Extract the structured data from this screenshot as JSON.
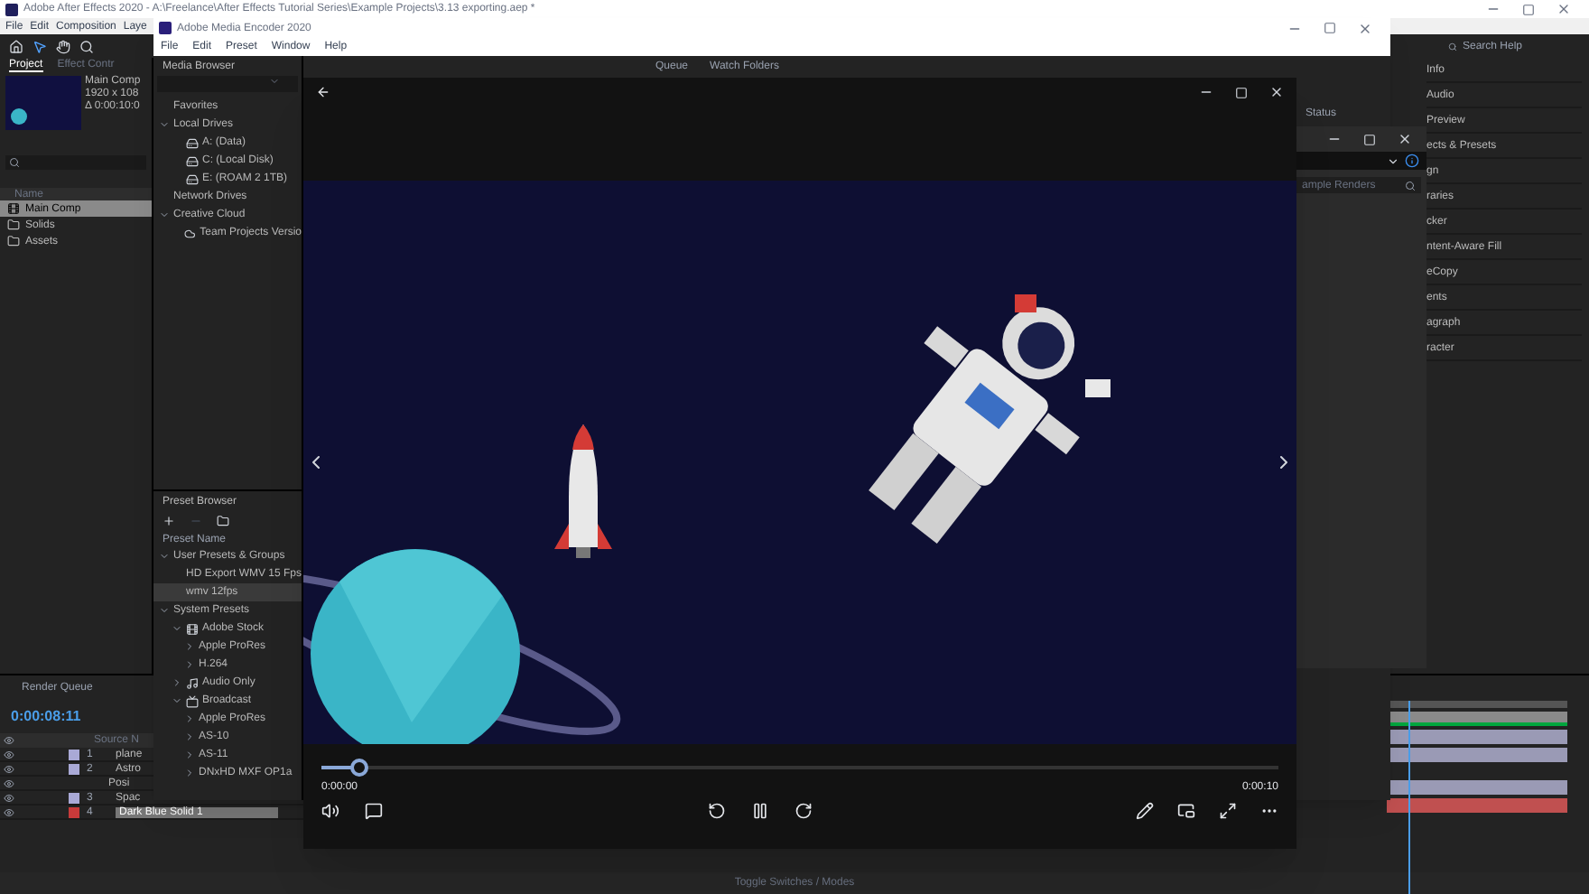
{
  "ae_window": {
    "title": "Adobe After Effects 2020 - A:\\Freelance\\After Effects Tutorial Series\\Example Projects\\3.13 exporting.aep *",
    "menu": [
      "File",
      "Edit",
      "Composition",
      "Laye"
    ],
    "search": {
      "placeholder": "Search Help"
    },
    "project_panel": {
      "tabs": [
        {
          "label": "Project",
          "selected": true
        },
        {
          "label": "Effect Contr",
          "selected": false
        }
      ],
      "comp_info": [
        "Main Comp",
        "1920 x 108",
        "Δ 0:00:10:0"
      ],
      "column": "Name",
      "items": [
        {
          "label": "Main Comp",
          "kind": "comp",
          "selected": true
        },
        {
          "label": "Solids",
          "kind": "folder",
          "selected": false
        },
        {
          "label": "Assets",
          "kind": "folder",
          "selected": false
        }
      ]
    },
    "panels": [
      "Info",
      "Audio",
      "Preview",
      "ects & Presets",
      "gn",
      "raries",
      "cker",
      "ntent-Aware Fill",
      "eCopy",
      "ents",
      "agraph",
      "racter"
    ],
    "timeline": {
      "tab": "Render Queue",
      "timecode": "0:00:08:11",
      "column": "Source N",
      "layers": [
        {
          "kind": "layer",
          "number": "1",
          "name": "plane",
          "color": "#a9a9d6"
        },
        {
          "kind": "layer",
          "number": "2",
          "name": "Astro",
          "color": "#a9a9d6"
        },
        {
          "kind": "property",
          "name": "Posi"
        },
        {
          "kind": "layer",
          "number": "3",
          "name": "Spac",
          "color": "#a9a9d6"
        },
        {
          "kind": "layer",
          "number": "4",
          "name": "Dark Blue Solid 1",
          "color": "#c83a3a"
        }
      ]
    },
    "footer": "Toggle Switches / Modes"
  },
  "me_window": {
    "title": "Adobe Media Encoder 2020",
    "menu": [
      "File",
      "Edit",
      "Preset",
      "Window",
      "Help"
    ],
    "media_browser": {
      "title": "Media Browser",
      "tree": [
        {
          "label": "Favorites"
        },
        {
          "label": "Local Drives",
          "children": [
            {
              "label": "A: (Data)",
              "kind": "drive"
            },
            {
              "label": "C: (Local Disk)",
              "kind": "drive"
            },
            {
              "label": "E: (ROAM 2 1TB)",
              "kind": "drive"
            }
          ]
        },
        {
          "label": "Network Drives"
        },
        {
          "label": "Creative Cloud",
          "children": [
            {
              "label": "Team Projects Versio",
              "kind": "cloud"
            }
          ]
        }
      ]
    },
    "queue_tabs": [
      "Queue",
      "Watch Folders"
    ],
    "status": "Status",
    "preset_browser": {
      "title": "Preset Browser",
      "column": "Preset Name",
      "tree": [
        {
          "label": "User Presets & Groups",
          "expanded": true,
          "children": [
            {
              "label": "HD Export WMV 15 Fps",
              "selected": false
            },
            {
              "label": "wmv 12fps",
              "selected": true
            }
          ]
        },
        {
          "label": "System Presets",
          "expanded": true,
          "children": [
            {
              "label": "Adobe Stock",
              "kind": "stock",
              "expanded": true,
              "children": [
                {
                  "label": "Apple ProRes",
                  "expanded": false
                },
                {
                  "label": "H.264",
                  "expanded": false
                }
              ]
            },
            {
              "label": "Audio Only",
              "kind": "audio",
              "expanded": false
            },
            {
              "label": "Broadcast",
              "kind": "broadcast",
              "expanded": true,
              "children": [
                {
                  "label": "Apple ProRes",
                  "expanded": false
                },
                {
                  "label": "AS-10",
                  "expanded": false
                },
                {
                  "label": "AS-11",
                  "expanded": false
                },
                {
                  "label": "DNxHD MXF OP1a",
                  "expanded": false
                }
              ]
            }
          ]
        }
      ]
    }
  },
  "queue_window": {
    "search": {
      "placeholder": "ample Renders"
    }
  },
  "player": {
    "time_current": "0:00:00",
    "time_total": "0:00:10",
    "level": 0.04,
    "playing": true
  }
}
